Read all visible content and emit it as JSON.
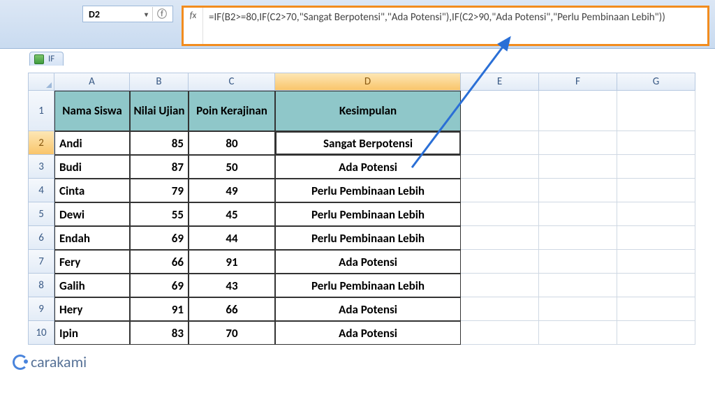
{
  "namebox": {
    "cell_ref": "D2"
  },
  "formula_bar": {
    "fx_label": "fx",
    "formula": "=IF(B2>=80,IF(C2>70,\"Sangat Berpotensi\",\"Ada Potensi\"),IF(C2>90,\"Ada Potensi\",\"Perlu Pembinaan Lebih\"))"
  },
  "document_tab": "IF",
  "columns": [
    "A",
    "B",
    "C",
    "D",
    "E",
    "F",
    "G"
  ],
  "selected_column": "D",
  "selected_row": 2,
  "headers": {
    "A": "Nama Siswa",
    "B": "Nilai Ujian",
    "C": "Poin Kerajinan",
    "D": "Kesimpulan"
  },
  "rows": [
    {
      "n": 2,
      "A": "Andi",
      "B": 85,
      "C": 80,
      "D": "Sangat Berpotensi"
    },
    {
      "n": 3,
      "A": "Budi",
      "B": 87,
      "C": 50,
      "D": "Ada Potensi"
    },
    {
      "n": 4,
      "A": "Cinta",
      "B": 79,
      "C": 49,
      "D": "Perlu Pembinaan Lebih"
    },
    {
      "n": 5,
      "A": "Dewi",
      "B": 55,
      "C": 45,
      "D": "Perlu Pembinaan Lebih"
    },
    {
      "n": 6,
      "A": "Endah",
      "B": 69,
      "C": 44,
      "D": "Perlu Pembinaan Lebih"
    },
    {
      "n": 7,
      "A": "Fery",
      "B": 66,
      "C": 91,
      "D": "Ada Potensi"
    },
    {
      "n": 8,
      "A": "Galih",
      "B": 69,
      "C": 43,
      "D": "Perlu Pembinaan Lebih"
    },
    {
      "n": 9,
      "A": "Hery",
      "B": 91,
      "C": 66,
      "D": "Ada Potensi"
    },
    {
      "n": 10,
      "A": "Ipin",
      "B": 83,
      "C": 70,
      "D": "Ada Potensi"
    }
  ],
  "watermark": "carakami",
  "chart_data": {
    "type": "table",
    "title": "IF",
    "columns": [
      "Nama Siswa",
      "Nilai Ujian",
      "Poin Kerajinan",
      "Kesimpulan"
    ],
    "records": [
      [
        "Andi",
        85,
        80,
        "Sangat Berpotensi"
      ],
      [
        "Budi",
        87,
        50,
        "Ada Potensi"
      ],
      [
        "Cinta",
        79,
        49,
        "Perlu Pembinaan Lebih"
      ],
      [
        "Dewi",
        55,
        45,
        "Perlu Pembinaan Lebih"
      ],
      [
        "Endah",
        69,
        44,
        "Perlu Pembinaan Lebih"
      ],
      [
        "Fery",
        66,
        91,
        "Ada Potensi"
      ],
      [
        "Galih",
        69,
        43,
        "Perlu Pembinaan Lebih"
      ],
      [
        "Hery",
        91,
        66,
        "Ada Potensi"
      ],
      [
        "Ipin",
        83,
        70,
        "Ada Potensi"
      ]
    ]
  }
}
